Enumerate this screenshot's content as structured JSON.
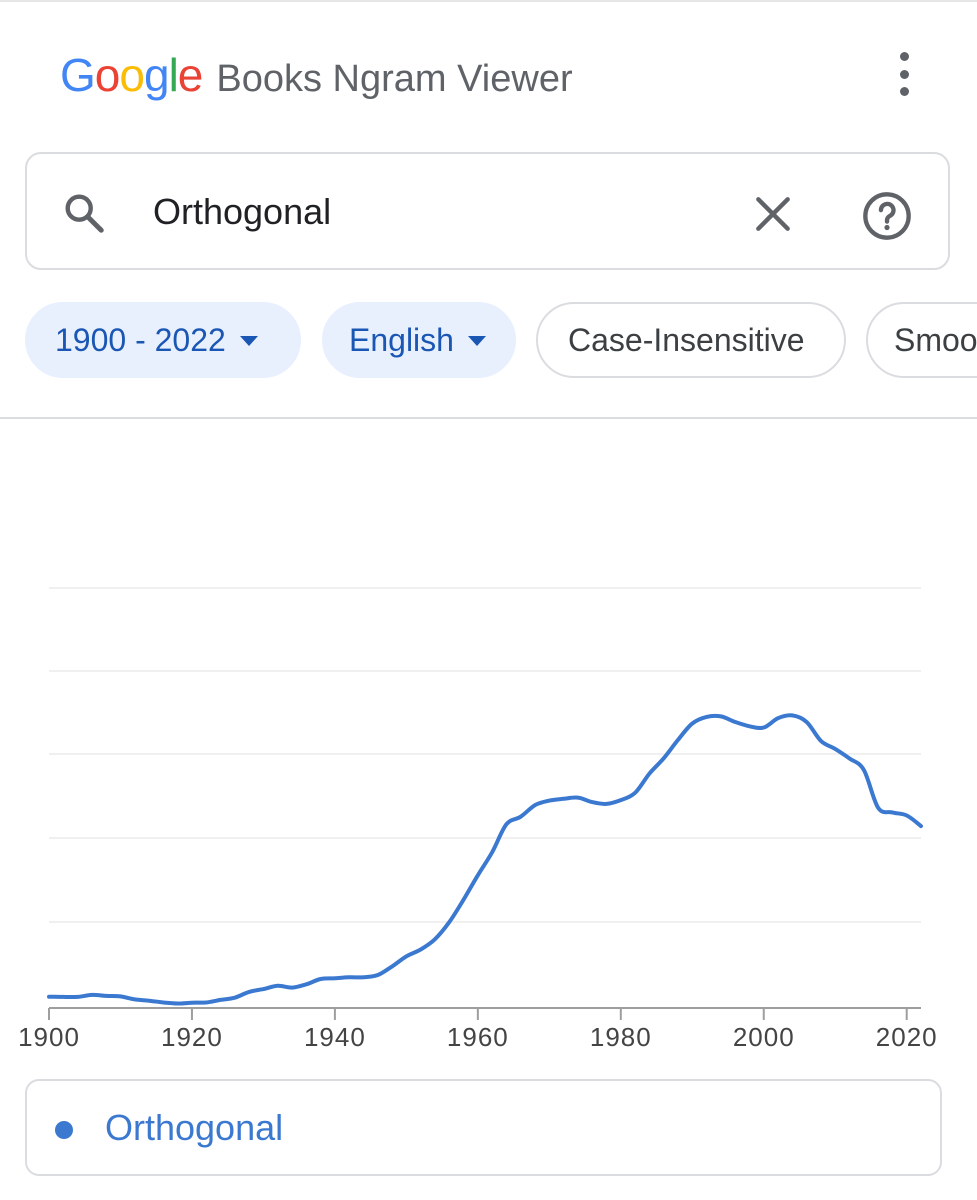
{
  "header": {
    "logo_text": "Google",
    "logo_colors": [
      "#4285F4",
      "#EA4335",
      "#FBBC05",
      "#4285F4",
      "#34A853",
      "#EA4335"
    ],
    "title": "Books Ngram Viewer",
    "menu_icon": "more-vert-icon"
  },
  "search": {
    "query": "Orthogonal",
    "icons": [
      "search-icon",
      "clear-icon",
      "help-icon"
    ]
  },
  "filters": {
    "year_range": "1900 - 2022",
    "corpus": "English",
    "case": "Case-Insensitive",
    "smoothing": "Smoo"
  },
  "colors": {
    "accent": "#3b78d0",
    "chip_active_bg": "#e8f0fe",
    "chip_active_text": "#1a56b3",
    "icon_gray": "#5f6368"
  },
  "chart_data": {
    "type": "line",
    "title": "",
    "xlabel": "",
    "ylabel": "",
    "xlim": [
      1900,
      2022
    ],
    "ylim": [
      0,
      100
    ],
    "x_ticks": [
      "1900",
      "1920",
      "1940",
      "1960",
      "1980",
      "2000",
      "2020"
    ],
    "grid": true,
    "legend": "bottom",
    "series": [
      {
        "name": "Orthogonal",
        "color": "#3b78d0",
        "x": [
          1900,
          1902,
          1904,
          1906,
          1908,
          1910,
          1912,
          1914,
          1916,
          1918,
          1920,
          1922,
          1924,
          1926,
          1928,
          1930,
          1932,
          1934,
          1936,
          1938,
          1940,
          1942,
          1944,
          1946,
          1948,
          1950,
          1952,
          1954,
          1956,
          1958,
          1960,
          1962,
          1964,
          1966,
          1968,
          1970,
          1972,
          1974,
          1976,
          1978,
          1980,
          1982,
          1984,
          1986,
          1988,
          1990,
          1992,
          1994,
          1996,
          1998,
          2000,
          2002,
          2004,
          2006,
          2008,
          2010,
          2012,
          2014,
          2016,
          2018,
          2020,
          2022
        ],
        "values": [
          4.5,
          4.4,
          4.4,
          5.2,
          4.8,
          4.6,
          3.4,
          2.9,
          2.2,
          1.8,
          2.1,
          2.2,
          3.2,
          4.1,
          6.4,
          7.5,
          8.8,
          8.1,
          9.4,
          11.5,
          11.8,
          12.2,
          12.2,
          13.1,
          16.5,
          20.5,
          23.2,
          27.3,
          34.1,
          43,
          52.7,
          61.8,
          72.9,
          75.9,
          80.5,
          82.3,
          83,
          83.5,
          81.7,
          81,
          82.5,
          85.4,
          93,
          99.1,
          106.4,
          112.9,
          115.5,
          115.7,
          113.5,
          111.8,
          111.3,
          115,
          116.1,
          113.5,
          106,
          102.8,
          99,
          94.5,
          79.5,
          77.6,
          76.4,
          72.2
        ]
      }
    ]
  },
  "legend": {
    "items": [
      {
        "label": "Orthogonal",
        "color": "#3b78d0"
      }
    ]
  }
}
